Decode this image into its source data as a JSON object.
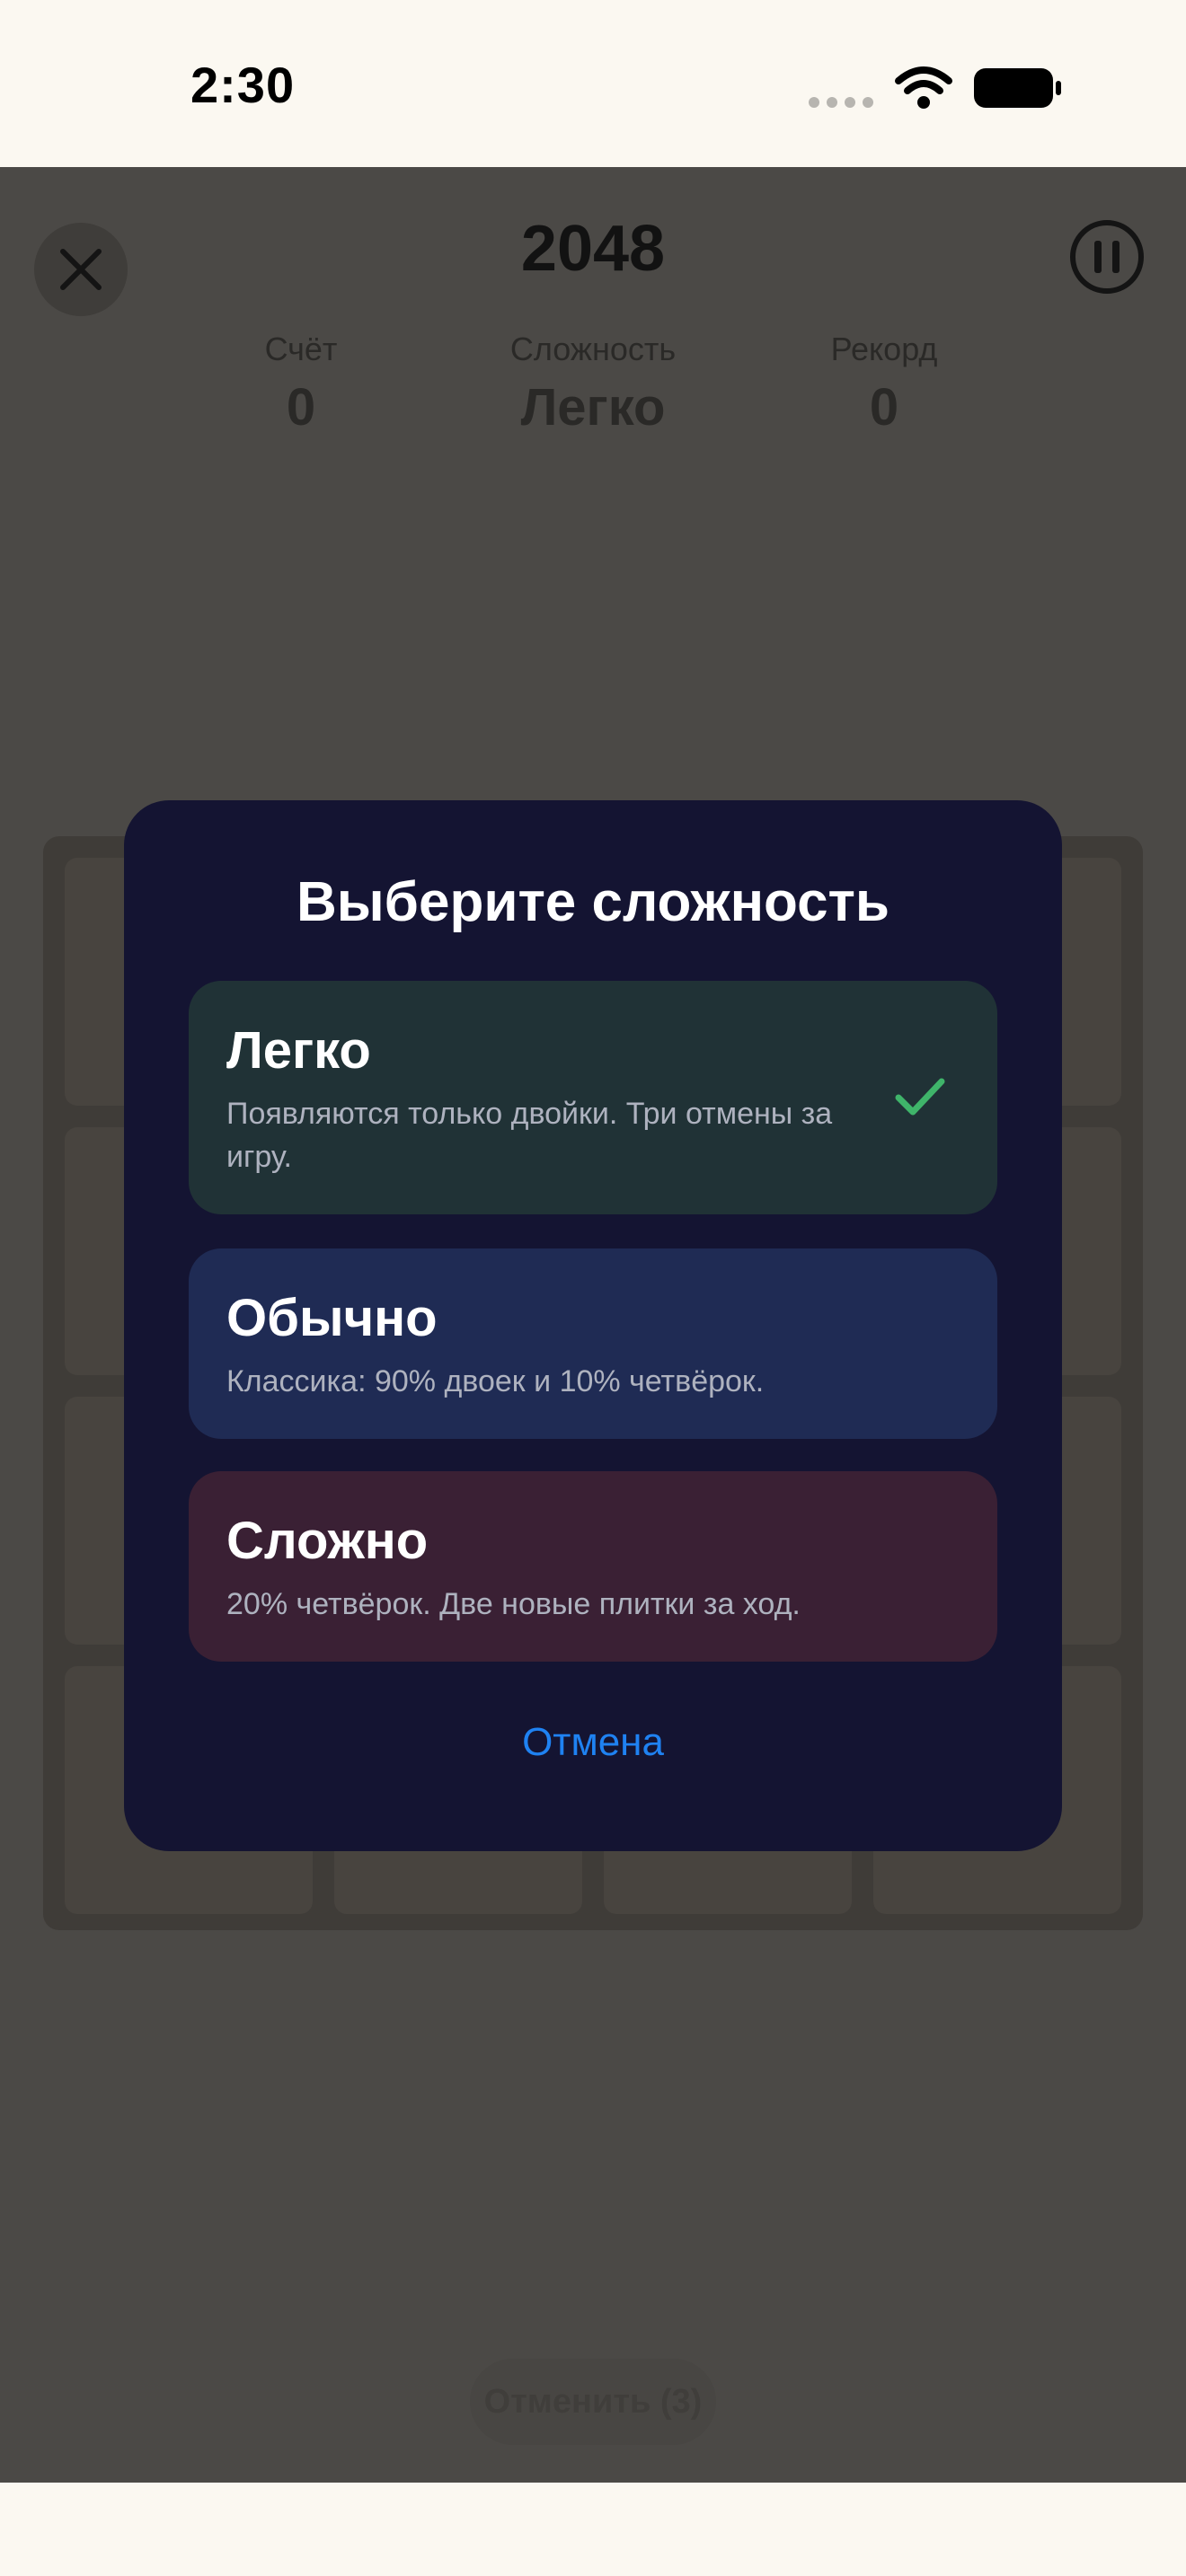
{
  "status_bar": {
    "time": "2:30",
    "icons": [
      "cellular-dots-icon",
      "wifi-icon",
      "battery-icon"
    ]
  },
  "header": {
    "title": "2048",
    "close_icon": "close-icon",
    "pause_icon": "pause-icon"
  },
  "stats": [
    {
      "label": "Счёт",
      "value": "0"
    },
    {
      "label": "Сложность",
      "value": "Легко"
    },
    {
      "label": "Рекорд",
      "value": "0"
    }
  ],
  "board": {
    "rows": 4,
    "cols": 4
  },
  "undo_button": {
    "label": "Отменить (3)"
  },
  "modal": {
    "title": "Выберите сложность",
    "options": [
      {
        "title": "Легко",
        "description": "Появляются только двойки. Три отмены за игру.",
        "selected": true,
        "color": "#203236"
      },
      {
        "title": "Обычно",
        "description": "Классика: 90% двоек и 10% четвёрок.",
        "selected": false,
        "color": "#1f2b54"
      },
      {
        "title": "Сложно",
        "description": "20% четвёрок. Две новые плитки за ход.",
        "selected": false,
        "color": "#3a2034"
      }
    ],
    "cancel_label": "Отмена"
  },
  "colors": {
    "modal_background": "#141432",
    "accent_link": "#1f82f2",
    "check": "#3fb46a",
    "overlay": "#4b4946"
  }
}
